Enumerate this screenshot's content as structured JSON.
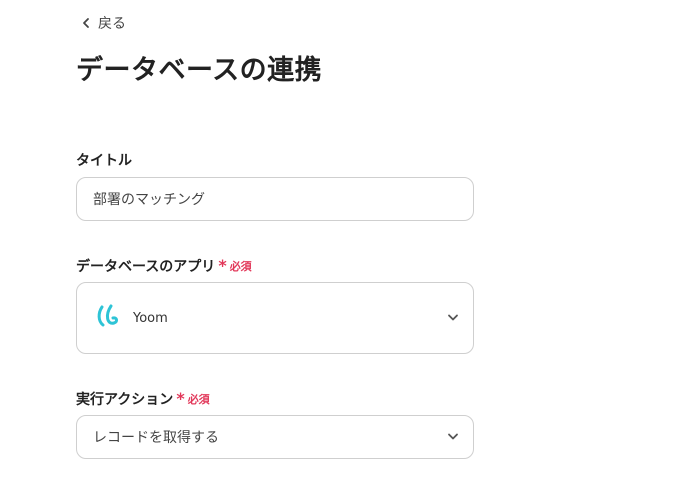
{
  "back": {
    "label": "戻る",
    "icon": "chevron-left-icon"
  },
  "page_title": "データベースの連携",
  "fields": {
    "title": {
      "label": "タイトル",
      "value": "部署のマッチング"
    },
    "app": {
      "label": "データベースのアプリ",
      "required_label": "必須",
      "value": "Yoom",
      "logo_icon": "yoom-logo",
      "logo_color": "#2ec4d6"
    },
    "action": {
      "label": "実行アクション",
      "required_label": "必須",
      "value": "レコードを取得する"
    }
  },
  "colors": {
    "required": "#e2385a",
    "border": "#cfcfcf"
  }
}
